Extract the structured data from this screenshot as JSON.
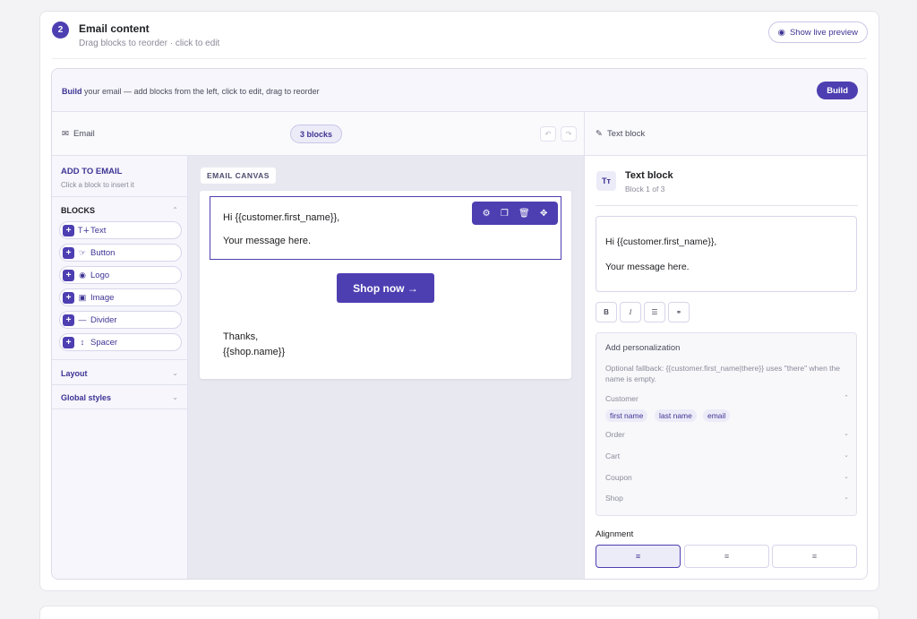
{
  "section": {
    "step_number": "2",
    "title": "Email content",
    "subtitle": "Drag blocks to reorder · click to edit",
    "preview_label": "Show live preview"
  },
  "build_bar": {
    "lead": "Build",
    "text": " your email — add blocks from the left, click to edit, drag to reorder",
    "button_label": "Build"
  },
  "header": {
    "email_label": "Email",
    "blocks_count": "3 blocks",
    "right_label": "Text block"
  },
  "left_panel": {
    "title": "ADD TO EMAIL",
    "subtitle": "Click a block to insert it",
    "blocks_heading": "BLOCKS",
    "blocks": [
      {
        "label": "Text",
        "icon": "text-icon"
      },
      {
        "label": "Button",
        "icon": "pointer-icon"
      },
      {
        "label": "Logo",
        "icon": "logo-icon"
      },
      {
        "label": "Image",
        "icon": "image-icon"
      },
      {
        "label": "Divider",
        "icon": "divider-icon"
      },
      {
        "label": "Spacer",
        "icon": "spacer-icon"
      }
    ],
    "layout_label": "Layout",
    "global_styles_label": "Global styles"
  },
  "canvas": {
    "tag": "EMAIL CANVAS",
    "text_line1": "Hi {{customer.first_name}},",
    "text_line2": "Your message here.",
    "button_label": "Shop now →",
    "footer_line1": "Thanks,",
    "footer_line2": "{{shop.name}}"
  },
  "right_panel": {
    "icon_text": "Tт",
    "title": "Text block",
    "subtitle": "Block 1 of 3",
    "editor_line1": "Hi {{customer.first_name}},",
    "editor_line2": "Your message here.",
    "format_buttons": [
      "B",
      "I",
      "☰",
      "⚭"
    ],
    "personalization": {
      "title": "Add personalization",
      "help": "Optional fallback: {{customer.first_name|there}} uses \"there\" when the name is empty.",
      "groups": [
        "Customer",
        "Order",
        "Cart",
        "Coupon",
        "Shop"
      ],
      "customer_chips": [
        "first name",
        "last name",
        "email"
      ]
    },
    "alignment_label": "Alignment",
    "alignment_options": [
      "≡",
      "≡",
      "≡"
    ]
  },
  "colors": {
    "accent": "#4d3fb1",
    "accent_light": "#ecebf8"
  }
}
